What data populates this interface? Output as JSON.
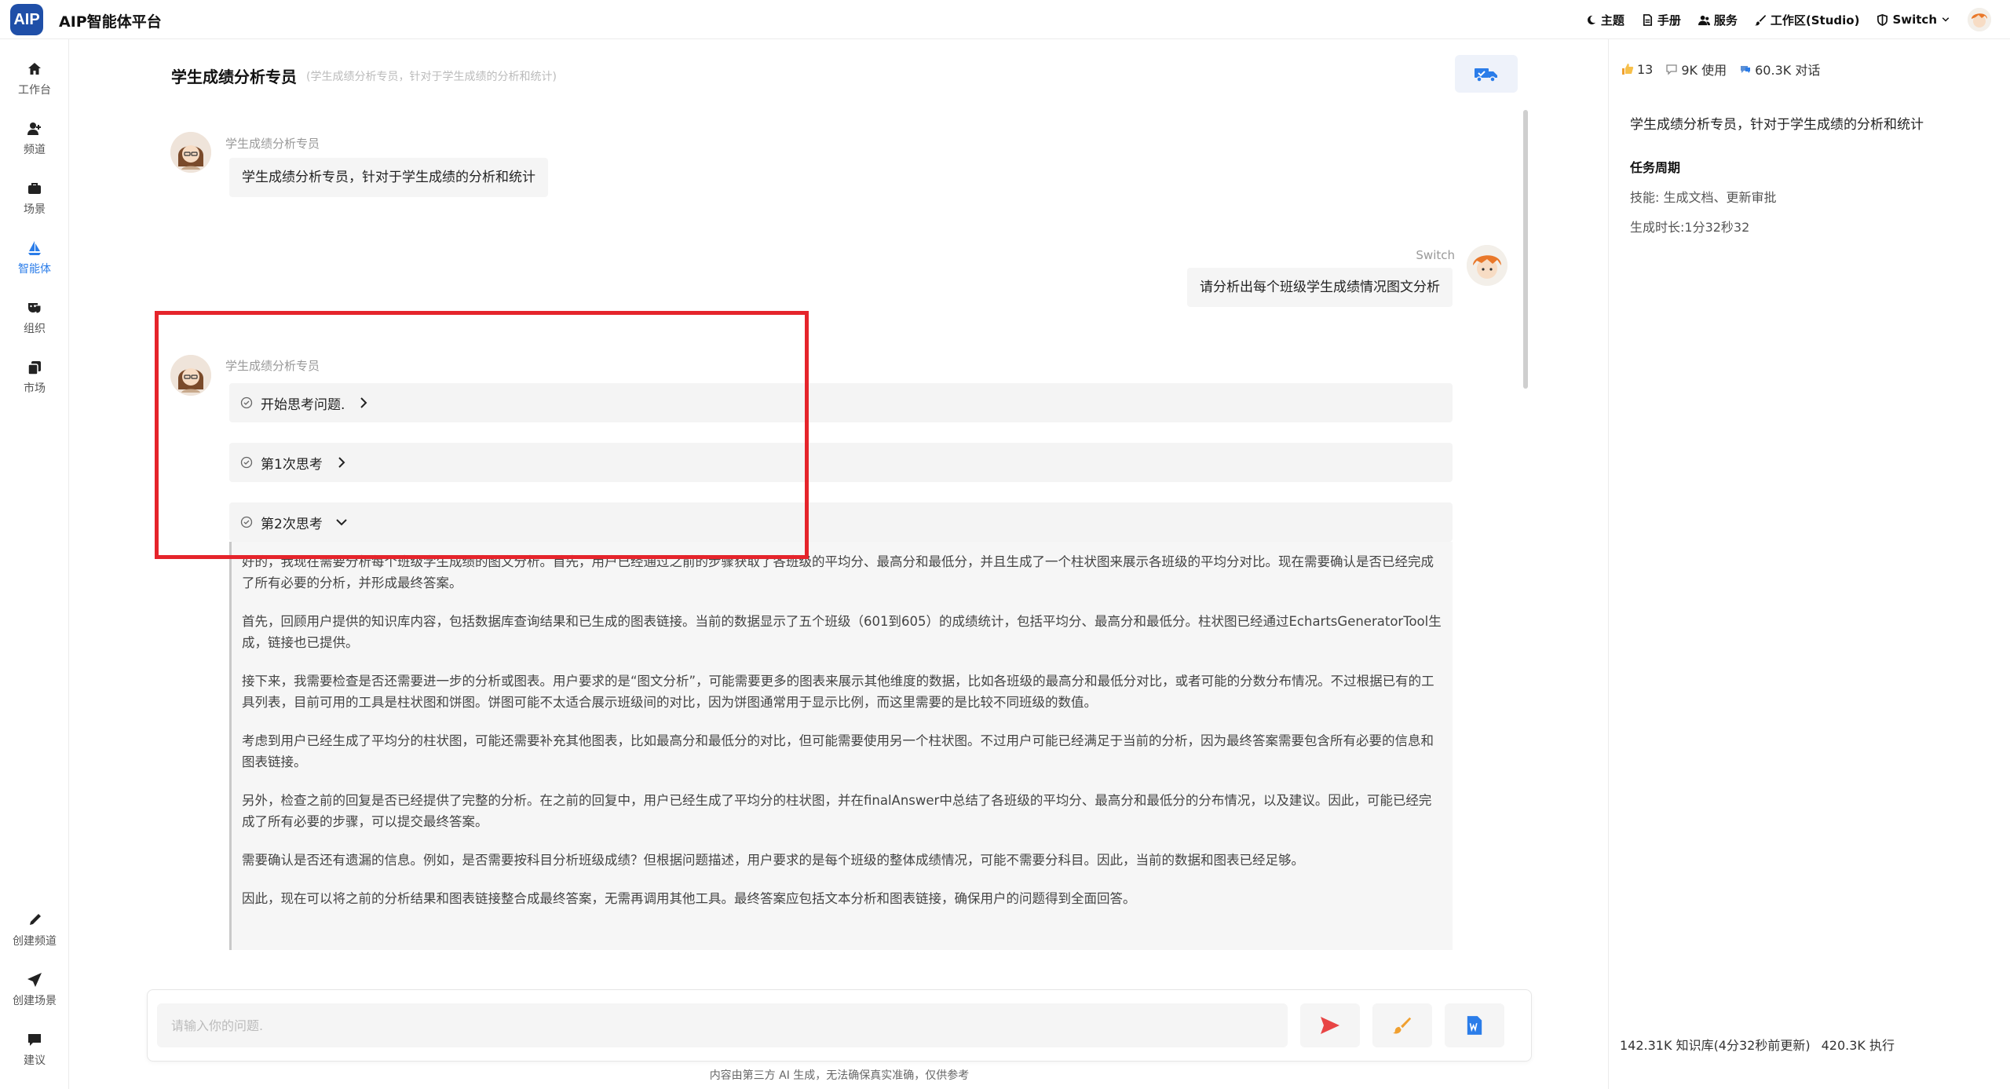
{
  "app": {
    "logo_text": "AIP",
    "title": "AIP智能体平台"
  },
  "topnav": [
    {
      "label": "主题",
      "icon": "moon-icon"
    },
    {
      "label": "手册",
      "icon": "document-icon"
    },
    {
      "label": "服务",
      "icon": "users-icon"
    },
    {
      "label": "工作区(Studio)",
      "icon": "brush-icon"
    },
    {
      "label": "Switch",
      "icon": "shield-icon"
    }
  ],
  "sidebar": {
    "items": [
      {
        "label": "工作台",
        "icon": "home-icon"
      },
      {
        "label": "频道",
        "icon": "user-add-icon"
      },
      {
        "label": "场景",
        "icon": "briefcase-icon"
      },
      {
        "label": "智能体",
        "icon": "sail-icon"
      },
      {
        "label": "组织",
        "icon": "mask-icon"
      },
      {
        "label": "市场",
        "icon": "copy-icon"
      }
    ],
    "bottom_items": [
      {
        "label": "创建频道",
        "icon": "pen-icon"
      },
      {
        "label": "创建场景",
        "icon": "send-icon"
      },
      {
        "label": "建议",
        "icon": "chat-icon"
      }
    ]
  },
  "chat": {
    "title": "学生成绩分析专员",
    "subtitle": "(学生成绩分析专员，针对于学生成绩的分析和统计)",
    "agent_name": "学生成绩分析专员",
    "greeting": "学生成绩分析专员，针对于学生成绩的分析和统计",
    "user_name": "Switch",
    "user_message": "请分析出每个班级学生成绩情况图文分析",
    "thinking_steps": [
      {
        "label": "开始思考问题.",
        "expanded": false
      },
      {
        "label": "第1次思考",
        "expanded": false
      },
      {
        "label": "第2次思考",
        "expanded": true
      }
    ],
    "thinking_paragraphs": [
      "好的，我现在需要分析每个班级学生成绩的图文分析。首先，用户已经通过之前的步骤获取了各班级的平均分、最高分和最低分，并且生成了一个柱状图来展示各班级的平均分对比。现在需要确认是否已经完成了所有必要的分析，并形成最终答案。",
      "首先，回顾用户提供的知识库内容，包括数据库查询结果和已生成的图表链接。当前的数据显示了五个班级（601到605）的成绩统计，包括平均分、最高分和最低分。柱状图已经通过EchartsGeneratorTool生成，链接也已提供。",
      "接下来，我需要检查是否还需要进一步的分析或图表。用户要求的是“图文分析”，可能需要更多的图表来展示其他维度的数据，比如各班级的最高分和最低分对比，或者可能的分数分布情况。不过根据已有的工具列表，目前可用的工具是柱状图和饼图。饼图可能不太适合展示班级间的对比，因为饼图通常用于显示比例，而这里需要的是比较不同班级的数值。",
      "考虑到用户已经生成了平均分的柱状图，可能还需要补充其他图表，比如最高分和最低分的对比，但可能需要使用另一个柱状图。不过用户可能已经满足于当前的分析，因为最终答案需要包含所有必要的信息和图表链接。",
      "另外，检查之前的回复是否已经提供了完整的分析。在之前的回复中，用户已经生成了平均分的柱状图，并在finalAnswer中总结了各班级的平均分、最高分和最低分的分布情况，以及建议。因此，可能已经完成了所有必要的步骤，可以提交最终答案。",
      "需要确认是否还有遗漏的信息。例如，是否需要按科目分析班级成绩？但根据问题描述，用户要求的是每个班级的整体成绩情况，可能不需要分科目。因此，当前的数据和图表已经足够。",
      "因此，现在可以将之前的分析结果和图表链接整合成最终答案，无需再调用其他工具。最终答案应包括文本分析和图表链接，确保用户的问题得到全面回答。"
    ]
  },
  "input": {
    "placeholder": "请输入你的问题.",
    "value": "",
    "disclaimer": "内容由第三方 AI 生成，无法确保真实准确，仅供参考"
  },
  "right_panel": {
    "stats": [
      {
        "icon": "thumbs-up-icon",
        "text": "13"
      },
      {
        "icon": "comment-icon",
        "text": "9K 使用"
      },
      {
        "icon": "chat-bubble-icon",
        "text": "60.3K 对话"
      }
    ],
    "description": "学生成绩分析专员，针对于学生成绩的分析和统计",
    "section_title": "任务周期",
    "skills": "技能:  生成文档、更新审批",
    "gen_time": "生成时长:1分32秒32",
    "kb_stats": "142.31K 知识库(4分32秒前更新)",
    "exec_stats": "420.3K 执行"
  },
  "colors": {
    "accent": "#1f4fa8",
    "highlight": "#e5242b",
    "send": "#e84545",
    "brush": "#f0a030",
    "word": "#2b7de9"
  }
}
